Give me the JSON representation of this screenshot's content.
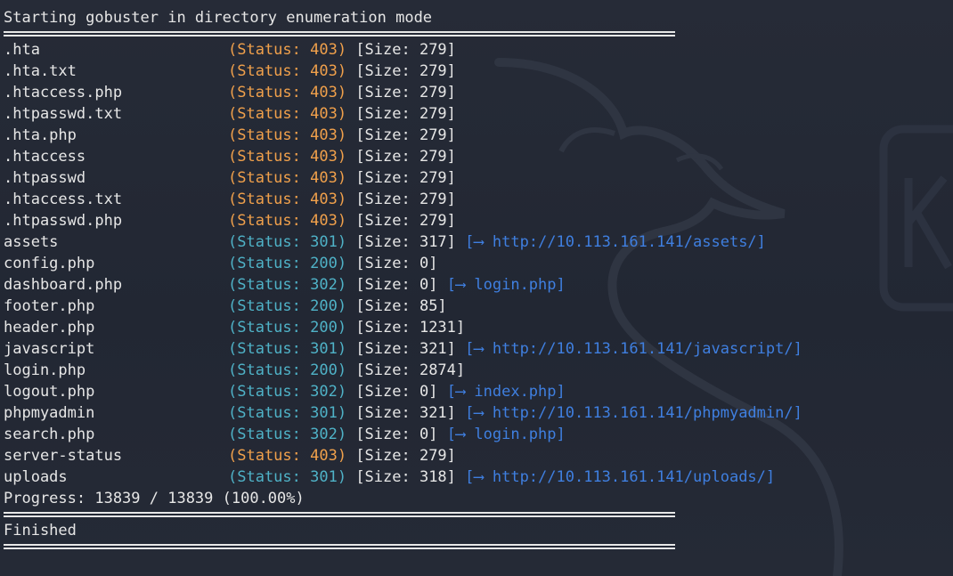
{
  "header": "Starting gobuster in directory enumeration mode",
  "results": [
    {
      "path": ".hta",
      "status": "(Status: 403)",
      "code": "403",
      "size": "[Size: 279]",
      "redirect": ""
    },
    {
      "path": ".hta.txt",
      "status": "(Status: 403)",
      "code": "403",
      "size": "[Size: 279]",
      "redirect": ""
    },
    {
      "path": ".htaccess.php",
      "status": "(Status: 403)",
      "code": "403",
      "size": "[Size: 279]",
      "redirect": ""
    },
    {
      "path": ".htpasswd.txt",
      "status": "(Status: 403)",
      "code": "403",
      "size": "[Size: 279]",
      "redirect": ""
    },
    {
      "path": ".hta.php",
      "status": "(Status: 403)",
      "code": "403",
      "size": "[Size: 279]",
      "redirect": ""
    },
    {
      "path": ".htaccess",
      "status": "(Status: 403)",
      "code": "403",
      "size": "[Size: 279]",
      "redirect": ""
    },
    {
      "path": ".htpasswd",
      "status": "(Status: 403)",
      "code": "403",
      "size": "[Size: 279]",
      "redirect": ""
    },
    {
      "path": ".htaccess.txt",
      "status": "(Status: 403)",
      "code": "403",
      "size": "[Size: 279]",
      "redirect": ""
    },
    {
      "path": ".htpasswd.php",
      "status": "(Status: 403)",
      "code": "403",
      "size": "[Size: 279]",
      "redirect": ""
    },
    {
      "path": "assets",
      "status": "(Status: 301)",
      "code": "301",
      "size": "[Size: 317]",
      "redirect": "[⟶ http://10.113.161.141/assets/]"
    },
    {
      "path": "config.php",
      "status": "(Status: 200)",
      "code": "200",
      "size": "[Size: 0]",
      "redirect": ""
    },
    {
      "path": "dashboard.php",
      "status": "(Status: 302)",
      "code": "302",
      "size": "[Size: 0]",
      "redirect": "[⟶ login.php]"
    },
    {
      "path": "footer.php",
      "status": "(Status: 200)",
      "code": "200",
      "size": "[Size: 85]",
      "redirect": ""
    },
    {
      "path": "header.php",
      "status": "(Status: 200)",
      "code": "200",
      "size": "[Size: 1231]",
      "redirect": ""
    },
    {
      "path": "javascript",
      "status": "(Status: 301)",
      "code": "301",
      "size": "[Size: 321]",
      "redirect": "[⟶ http://10.113.161.141/javascript/]"
    },
    {
      "path": "login.php",
      "status": "(Status: 200)",
      "code": "200",
      "size": "[Size: 2874]",
      "redirect": ""
    },
    {
      "path": "logout.php",
      "status": "(Status: 302)",
      "code": "302",
      "size": "[Size: 0]",
      "redirect": "[⟶ index.php]"
    },
    {
      "path": "phpmyadmin",
      "status": "(Status: 301)",
      "code": "301",
      "size": "[Size: 321]",
      "redirect": "[⟶ http://10.113.161.141/phpmyadmin/]"
    },
    {
      "path": "search.php",
      "status": "(Status: 302)",
      "code": "302",
      "size": "[Size: 0]",
      "redirect": "[⟶ login.php]"
    },
    {
      "path": "server-status",
      "status": "(Status: 403)",
      "code": "403",
      "size": "[Size: 279]",
      "redirect": ""
    },
    {
      "path": "uploads",
      "status": "(Status: 301)",
      "code": "301",
      "size": "[Size: 318]",
      "redirect": "[⟶ http://10.113.161.141/uploads/]"
    }
  ],
  "progress": "Progress: 13839 / 13839 (100.00%)",
  "footer": "Finished",
  "colors": {
    "background": "#232834",
    "text": "#e6e6e6",
    "status_403": "#f0a04b",
    "status_ok": "#4fb2c7",
    "redirect": "#3f7fe0"
  },
  "icons": {
    "background_art": "kali-dragon-watermark"
  }
}
